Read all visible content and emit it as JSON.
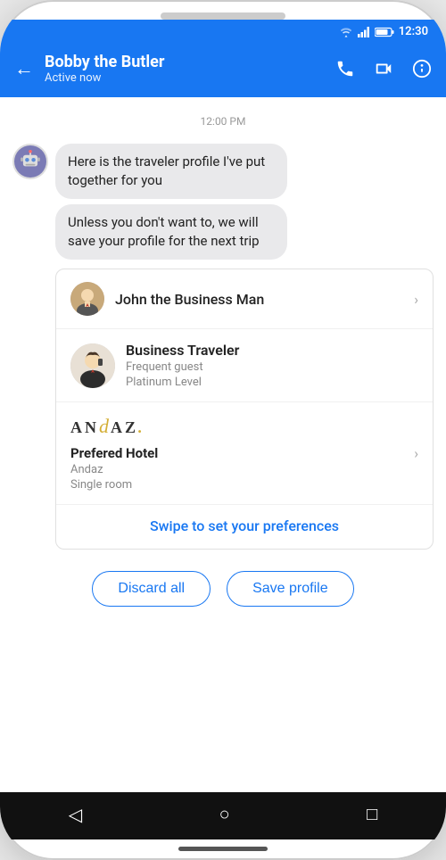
{
  "statusBar": {
    "time": "12:30",
    "batteryIcon": "🔋",
    "signalIcon": "▲"
  },
  "header": {
    "backLabel": "←",
    "name": "Bobby the Butler",
    "status": "Active now",
    "callIcon": "📞",
    "videoIcon": "🎥",
    "infoIcon": "ⓘ"
  },
  "chat": {
    "timestamp": "12:00 PM",
    "messages": [
      "Here is the traveler profile I've put together for you",
      "Unless you don't want to, we will save your profile for the next trip"
    ]
  },
  "profileCard": {
    "name": "John the Business Man",
    "chevron": "›"
  },
  "travelerCard": {
    "type": "Business Traveler",
    "sub1": "Frequent guest",
    "sub2": "Platinum Level"
  },
  "hotelCard": {
    "logoAnd": "AN",
    "logoD": "d",
    "logoAZ": "AZ",
    "logoDot": ".",
    "label": "Prefered Hotel",
    "hotelName": "Andaz",
    "roomType": "Single room",
    "chevron": "›"
  },
  "swipe": {
    "label": "Swipe to set your preferences"
  },
  "actions": {
    "discard": "Discard all",
    "save": "Save profile"
  },
  "navBar": {
    "back": "◁",
    "home": "○",
    "recent": "□"
  }
}
